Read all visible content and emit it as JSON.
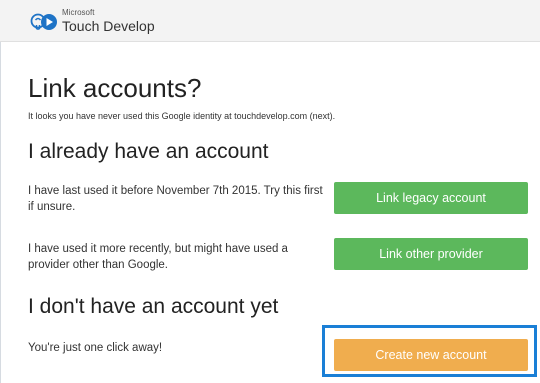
{
  "header": {
    "brand_small": "Microsoft",
    "brand_name": "Touch Develop"
  },
  "main": {
    "title": "Link accounts?",
    "subtitle": "It looks you have never used this Google identity at touchdevelop.com (next).",
    "have_account": {
      "heading": "I already have an account",
      "legacy_text": "I have last used it before November 7th 2015. Try this first if unsure.",
      "legacy_button": "Link legacy account",
      "provider_text": "I have used it more recently, but might have used a provider other than Google.",
      "provider_button": "Link other provider"
    },
    "no_account": {
      "heading": "I don't have an account yet",
      "text": "You're just one click away!",
      "create_button": "Create new account"
    }
  },
  "colors": {
    "green_button": "#5cb85c",
    "orange_button": "#f0ad4e",
    "focus_ring": "#1a7fd6"
  }
}
